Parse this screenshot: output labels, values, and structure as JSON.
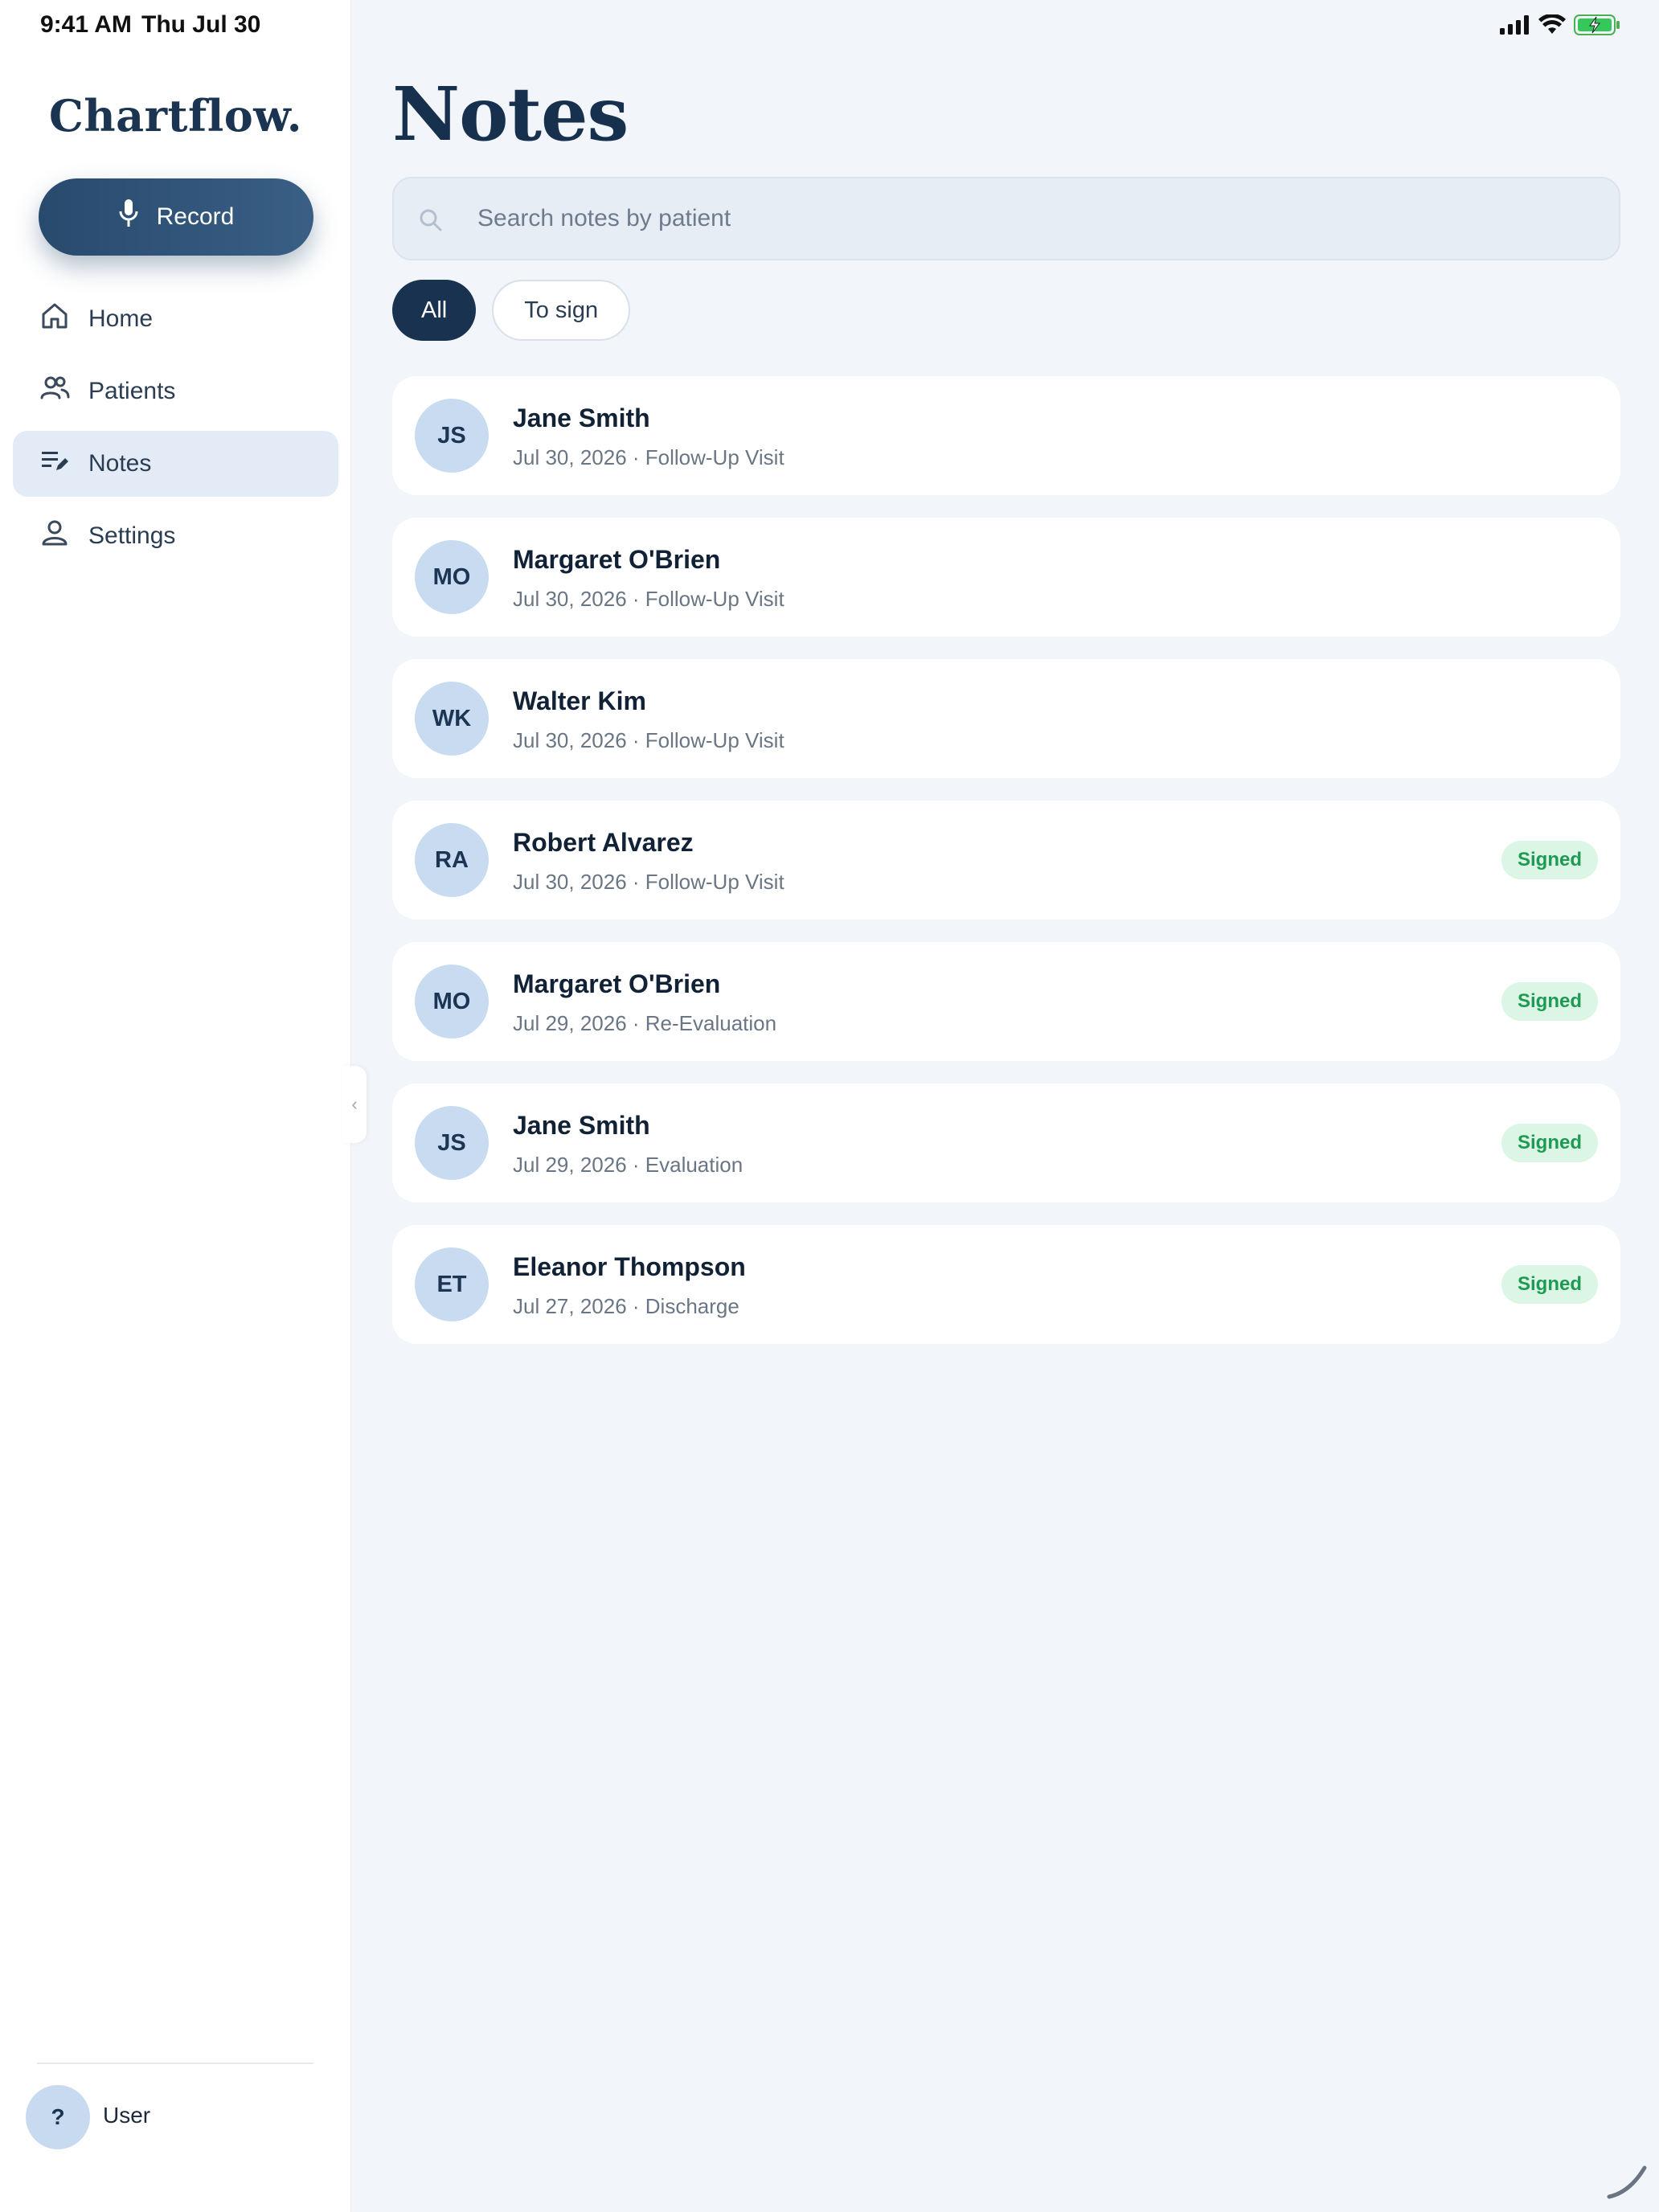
{
  "status_bar": {
    "time": "9:41 AM",
    "date": "Thu Jul 30",
    "icons": [
      "signal-icon",
      "wifi-icon",
      "battery-charging-icon"
    ]
  },
  "sidebar": {
    "logo": "Chartflow.",
    "record_label": "Record",
    "nav": [
      {
        "label": "Home",
        "icon": "home-icon",
        "active": false
      },
      {
        "label": "Patients",
        "icon": "patients-icon",
        "active": false
      },
      {
        "label": "Notes",
        "icon": "notes-icon",
        "active": true
      },
      {
        "label": "Settings",
        "icon": "settings-person-icon",
        "active": false
      }
    ],
    "user": {
      "initial": "?",
      "name": "User"
    },
    "collapse_glyph": "‹"
  },
  "main": {
    "title": "Notes",
    "search": {
      "placeholder": "Search notes by patient"
    },
    "filters": [
      {
        "label": "All",
        "active": true
      },
      {
        "label": "To sign",
        "active": false
      }
    ],
    "notes": [
      {
        "initials": "JS",
        "name": "Jane Smith",
        "meta": "Jul 30, 2026 · Follow-Up Visit",
        "badge": null
      },
      {
        "initials": "MO",
        "name": "Margaret O'Brien",
        "meta": "Jul 30, 2026 · Follow-Up Visit",
        "badge": null
      },
      {
        "initials": "WK",
        "name": "Walter Kim",
        "meta": "Jul 30, 2026 · Follow-Up Visit",
        "badge": null
      },
      {
        "initials": "RA",
        "name": "Robert Alvarez",
        "meta": "Jul 30, 2026 · Follow-Up Visit",
        "badge": "Signed"
      },
      {
        "initials": "MO",
        "name": "Margaret O'Brien",
        "meta": "Jul 29, 2026 · Re-Evaluation",
        "badge": "Signed"
      },
      {
        "initials": "JS",
        "name": "Jane Smith",
        "meta": "Jul 29, 2026 · Evaluation",
        "badge": "Signed"
      },
      {
        "initials": "ET",
        "name": "Eleanor Thompson",
        "meta": "Jul 27, 2026 · Discharge",
        "badge": "Signed"
      }
    ]
  },
  "colors": {
    "brand_dark": "#19324f",
    "record_gradient_start": "#284a6d",
    "record_gradient_end": "#3a5f85",
    "nav_active_bg": "#e3ecf6",
    "avatar_bg": "#c8dbf0",
    "signed_bg": "#dcf6e5",
    "signed_text": "#1f9a55",
    "page_bg": "#f2f5fa"
  }
}
